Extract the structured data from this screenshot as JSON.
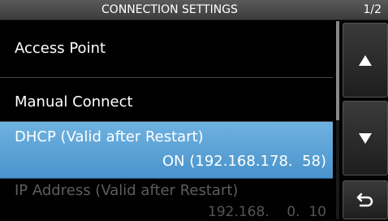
{
  "header": {
    "title": "CONNECTION SETTINGS",
    "page": "1/2"
  },
  "items": [
    {
      "label": "Access Point",
      "value": ""
    },
    {
      "label": "Manual Connect",
      "value": ""
    },
    {
      "label": "DHCP (Valid after Restart)",
      "value": "ON (192.168.178.  58)"
    },
    {
      "label": "IP Address (Valid after Restart)",
      "value": "192.168.    0.  10"
    }
  ],
  "selected_item": "DHCP (Valid after Restart)",
  "scroll_position_fraction": 0.0,
  "controls": {
    "up_icon": "triangle-up-icon",
    "down_icon": "triangle-down-icon",
    "back_icon": "return-arrow-icon"
  },
  "colors": {
    "selected_row": "#4a93cc",
    "disabled_text": "#5d5d5d"
  }
}
